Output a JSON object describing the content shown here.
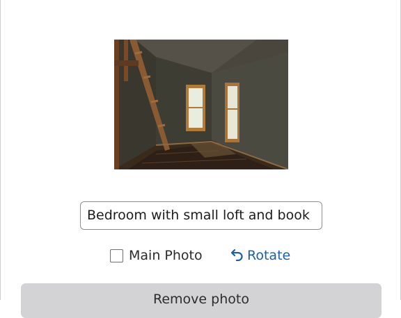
{
  "photo": {
    "alt_icon": "room-photo"
  },
  "caption": {
    "value": "Bedroom with small loft and book"
  },
  "main_photo": {
    "label": "Main Photo",
    "checked": false
  },
  "rotate": {
    "icon": "rotate-icon",
    "label": "Rotate"
  },
  "remove_button": {
    "label": "Remove photo"
  },
  "colors": {
    "link": "#1a5fa8",
    "button_bg": "#d3d3d6",
    "input_border": "#8f8f8f"
  }
}
